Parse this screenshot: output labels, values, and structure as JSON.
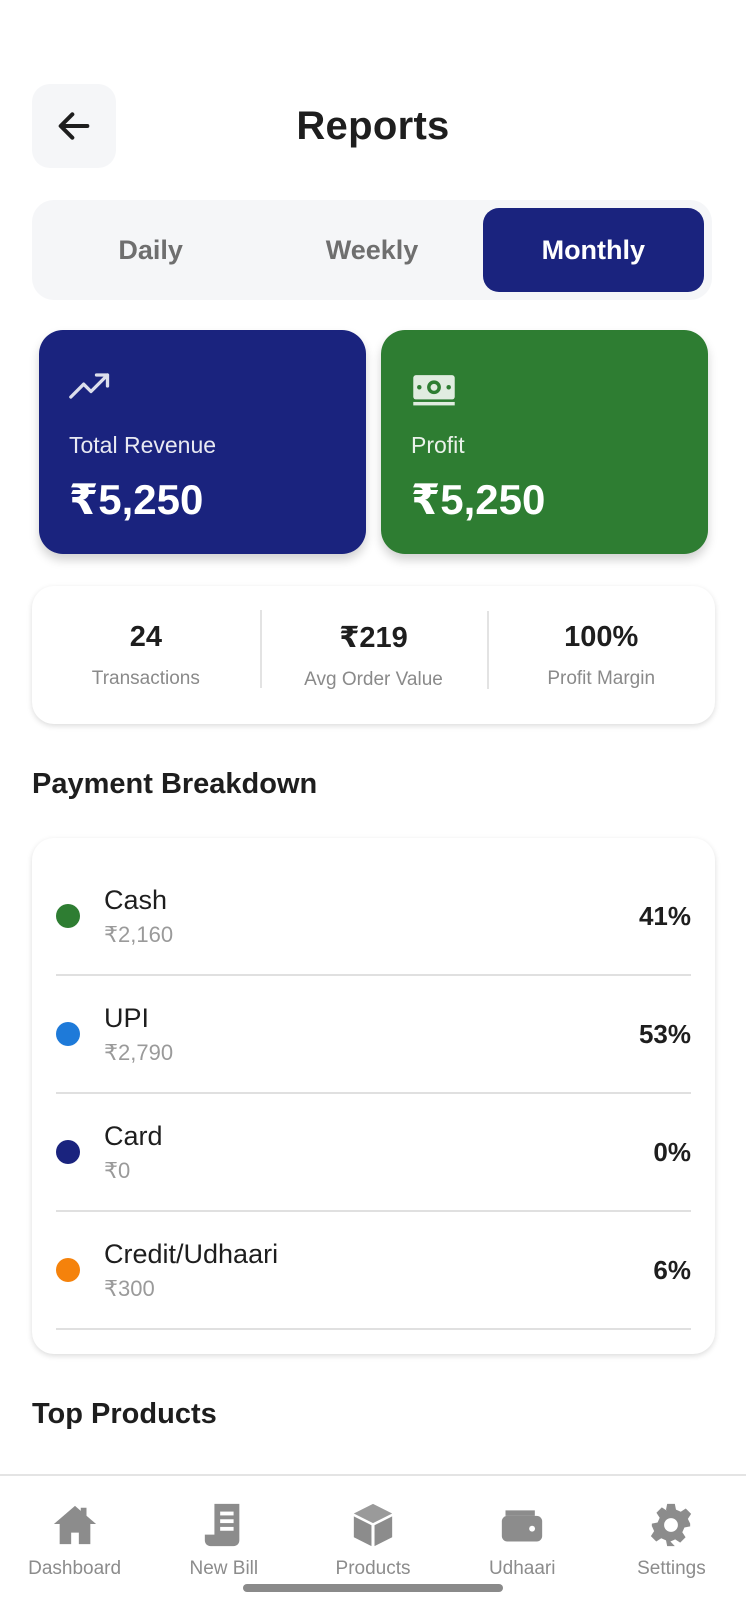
{
  "header": {
    "back_icon": "arrow-left-icon",
    "title": "Reports"
  },
  "tabs": [
    {
      "label": "Daily",
      "active": false
    },
    {
      "label": "Weekly",
      "active": false
    },
    {
      "label": "Monthly",
      "active": true
    }
  ],
  "summary": {
    "revenue": {
      "icon": "trending-up-icon",
      "label": "Total Revenue",
      "value": "₹5,250",
      "color": "#1a237e"
    },
    "profit": {
      "icon": "cash-icon",
      "label": "Profit",
      "value": "₹5,250",
      "color": "#2e7d32"
    }
  },
  "stats": [
    {
      "value": "24",
      "label": "Transactions"
    },
    {
      "value": "₹219",
      "label": "Avg Order Value"
    },
    {
      "value": "100%",
      "label": "Profit Margin"
    }
  ],
  "payment_breakdown": {
    "title": "Payment Breakdown",
    "items": [
      {
        "name": "Cash",
        "amount": "₹2,160",
        "percent": "41%",
        "color": "#2e7d32"
      },
      {
        "name": "UPI",
        "amount": "₹2,790",
        "percent": "53%",
        "color": "#1e7ad9"
      },
      {
        "name": "Card",
        "amount": "₹0",
        "percent": "0%",
        "color": "#1a237e"
      },
      {
        "name": "Credit/Udhaari",
        "amount": "₹300",
        "percent": "6%",
        "color": "#f5820b"
      }
    ]
  },
  "top_products": {
    "title": "Top Products"
  },
  "nav": [
    {
      "label": "Dashboard",
      "icon": "home-icon"
    },
    {
      "label": "New Bill",
      "icon": "receipt-icon"
    },
    {
      "label": "Products",
      "icon": "box-icon"
    },
    {
      "label": "Udhaari",
      "icon": "wallet-icon"
    },
    {
      "label": "Settings",
      "icon": "gear-icon"
    }
  ]
}
